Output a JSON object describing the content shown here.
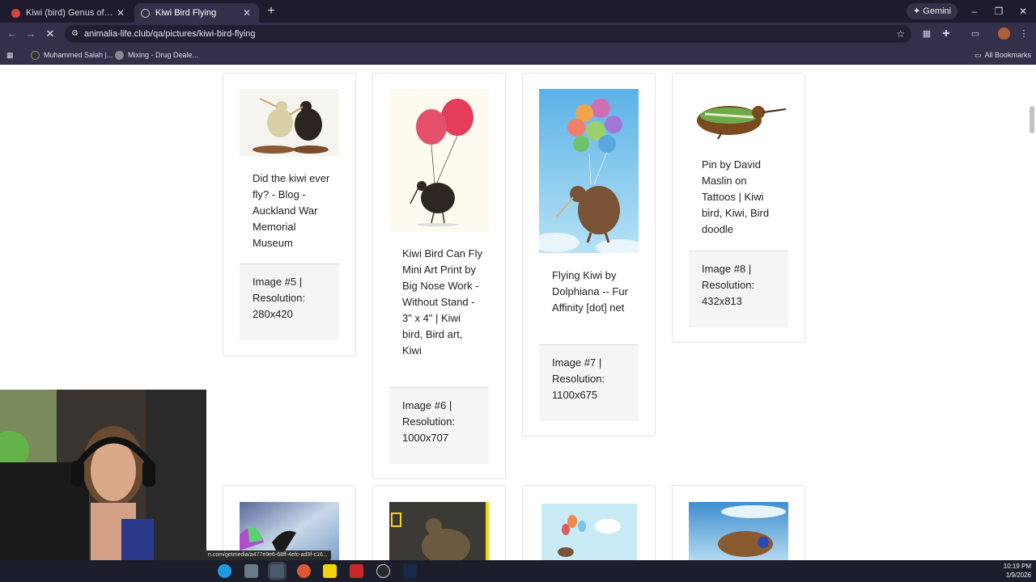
{
  "browser": {
    "tabs": [
      {
        "title": "Kiwi (bird) Genus of birds at Du",
        "active": false
      },
      {
        "title": "Kiwi Bird Flying",
        "active": true
      }
    ],
    "gemini_label": "Gemini",
    "url": "animalia-life.club/qa/pictures/kiwi-bird-flying",
    "bookmarks": [
      {
        "label": "Muhammed Salah |..."
      },
      {
        "label": "Mixing - Drug Deale..."
      }
    ],
    "all_bookmarks_label": "All Bookmarks"
  },
  "gallery": {
    "cards": [
      {
        "caption": "Did the kiwi ever fly? - Blog - Auckland War Memorial Museum",
        "image_label": "Image #5 |",
        "resolution": "Resolution: 280x420"
      },
      {
        "caption": "Kiwi Bird Can Fly Mini Art Print by Big Nose Work - Without Stand - 3\" x 4\" | Kiwi bird, Bird art, Kiwi",
        "image_label": "Image #6 |",
        "resolution": "Resolution: 1000x707"
      },
      {
        "caption": "Flying Kiwi by Dolphiana -- Fur Affinity [dot] net",
        "image_label": "Image #7 |",
        "resolution": "Resolution: 1100x675"
      },
      {
        "caption": "Pin by David Maslin on Tattoos | Kiwi bird, Kiwi, Bird doodle",
        "image_label": "Image #8 |",
        "resolution": "Resolution: 432x813"
      }
    ]
  },
  "status_url": "n.com/getmedia/a477e9e6-68ff-4efc-ad9f-c16...",
  "taskbar": {
    "time": "10:19 PM",
    "date": "1/9/2026"
  }
}
